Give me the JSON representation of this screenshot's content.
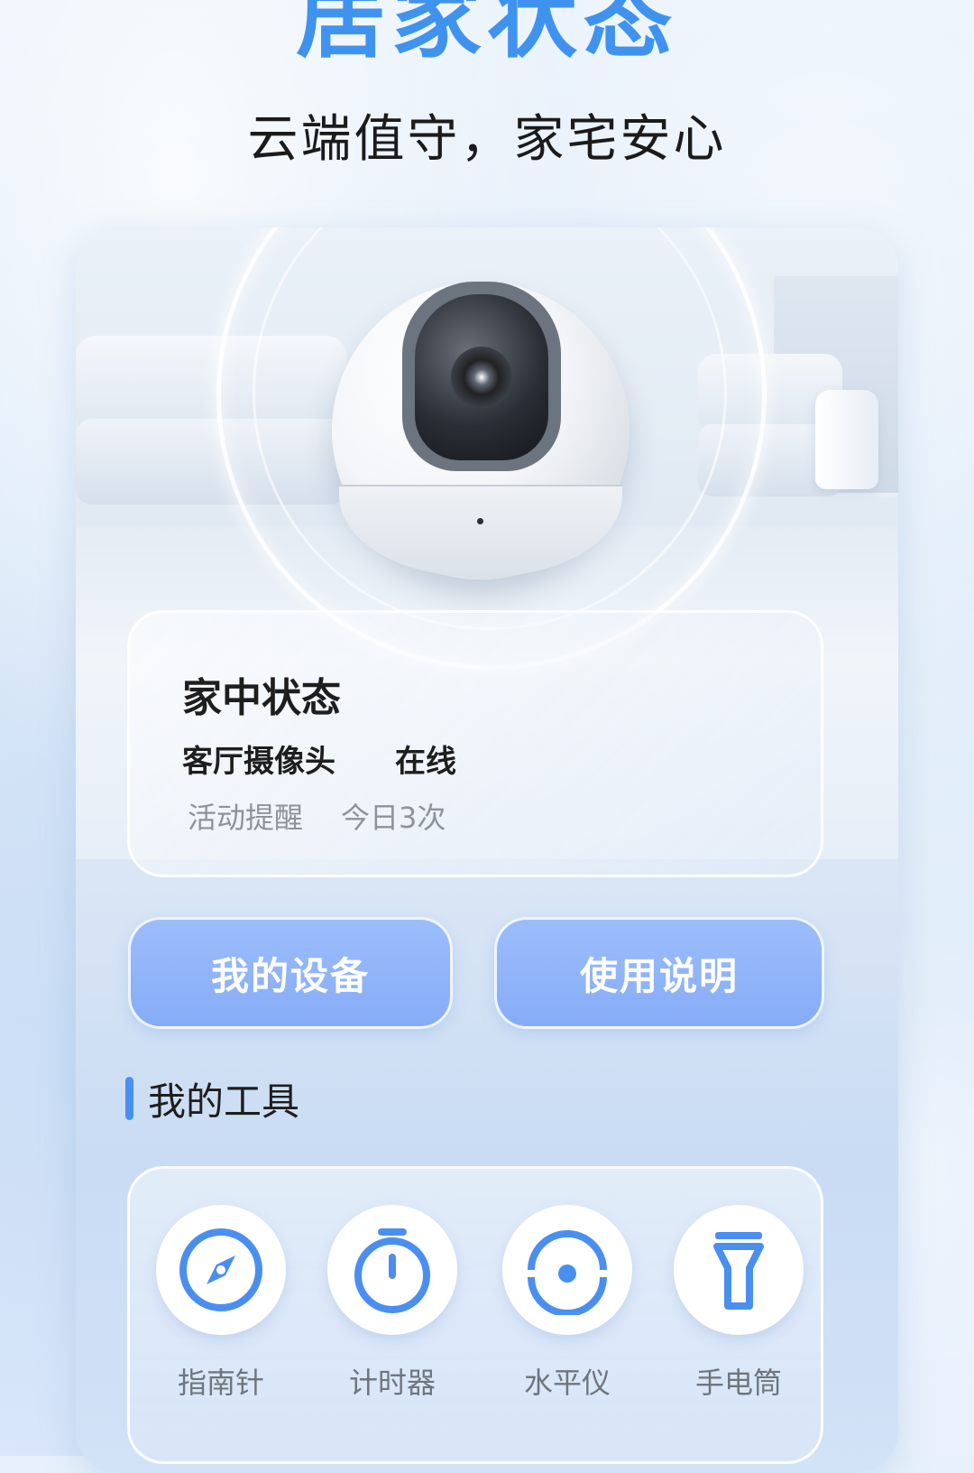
{
  "header": {
    "title": "居家状态",
    "subtitle": "云端值守，家宅安心"
  },
  "status": {
    "title": "家中状态",
    "device_name": "客厅摄像头",
    "device_state": "在线",
    "activity_label": "活动提醒",
    "activity_value": "今日3次"
  },
  "actions": {
    "my_devices": "我的设备",
    "manual": "使用说明"
  },
  "tools": {
    "title": "我的工具",
    "items": [
      {
        "label": "指南针",
        "icon": "compass-icon"
      },
      {
        "label": "计时器",
        "icon": "timer-icon"
      },
      {
        "label": "水平仪",
        "icon": "level-icon"
      },
      {
        "label": "手电筒",
        "icon": "flashlight-icon"
      }
    ]
  },
  "colors": {
    "accent": "#3f93ef",
    "button": "#8fb3f8",
    "icon": "#4a8ff0"
  }
}
